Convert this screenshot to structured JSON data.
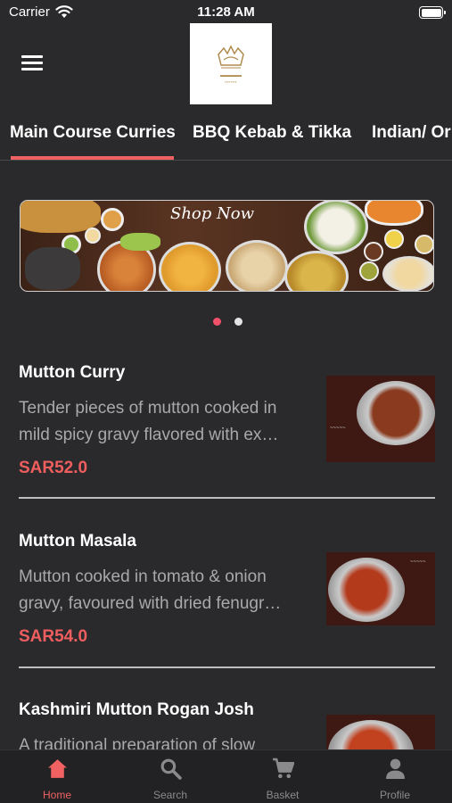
{
  "status_bar": {
    "carrier": "Carrier",
    "time": "11:28 AM"
  },
  "tabs": [
    {
      "label": "Main Course Curries",
      "active": true
    },
    {
      "label": "BBQ Kebab & Tikka",
      "active": false
    },
    {
      "label": "Indian/ Or",
      "active": false
    }
  ],
  "banner": {
    "text": "Shop Now",
    "slides": 2,
    "active_slide": 1
  },
  "items": [
    {
      "name": "Mutton Curry",
      "desc": "Tender pieces of mutton cooked in mild spicy gravy flavored with ex…",
      "price": "SAR52.0"
    },
    {
      "name": "Mutton Masala",
      "desc": "Mutton cooked in tomato & onion gravy, favoured with dried fenugr…",
      "price": "SAR54.0"
    },
    {
      "name": "Kashmiri Mutton Rogan Josh",
      "desc": "A traditional preparation of slow",
      "price": ""
    }
  ],
  "bottom_nav": [
    {
      "label": "Home",
      "icon": "home-icon",
      "active": true
    },
    {
      "label": "Search",
      "icon": "search-icon",
      "active": false
    },
    {
      "label": "Basket",
      "icon": "cart-icon",
      "active": false
    },
    {
      "label": "Profile",
      "icon": "profile-icon",
      "active": false
    }
  ],
  "colors": {
    "accent": "#f06262",
    "background": "#2a2a2d",
    "muted_text": "#a9a9ab",
    "inactive_nav": "#8a8a8c"
  }
}
